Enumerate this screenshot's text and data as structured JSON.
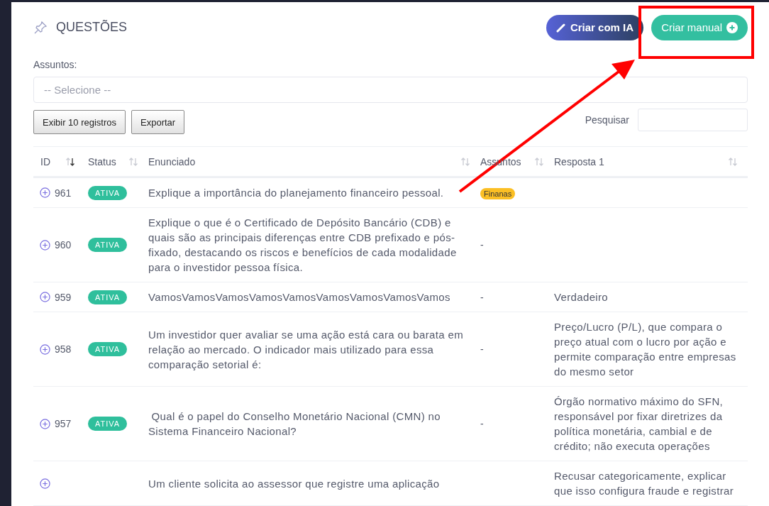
{
  "page": {
    "title": "QUESTÕES"
  },
  "actions": [
    {
      "label": "Criar com IA",
      "kind": "ai"
    },
    {
      "label": "Criar manual",
      "kind": "manual"
    }
  ],
  "filter": {
    "label": "Assuntos:",
    "placeholder": "-- Selecione --"
  },
  "toolbar": {
    "buttons": [
      "Exibir 10 registros",
      "Exportar"
    ],
    "search_label": "Pesquisar"
  },
  "table": {
    "columns": [
      {
        "label": "ID",
        "sorted": true
      },
      {
        "label": "Status",
        "sorted": false
      },
      {
        "label": "Enunciado",
        "sorted": false
      },
      {
        "label": "Assuntos",
        "sorted": false
      },
      {
        "label": "Resposta 1",
        "sorted": false
      }
    ],
    "rows": [
      {
        "id": "961",
        "status": "ATIVA",
        "enunciado": "Explique a importância do planejamento financeiro pessoal.",
        "assuntos": [
          {
            "label": "Finanas",
            "color": "#fbbf24"
          }
        ],
        "resposta": ""
      },
      {
        "id": "960",
        "status": "ATIVA",
        "enunciado": "Explique o que é o Certificado de Depósito Bancário (CDB) e quais são as principais diferenças entre CDB prefixado e pós-fixado, destacando os riscos e benefícios de cada modalidade para o investidor pessoa física.",
        "assuntos_text": "-",
        "resposta": ""
      },
      {
        "id": "959",
        "status": "ATIVA",
        "enunciado": "VamosVamosVamosVamosVamosVamosVamosVamosVamos",
        "assuntos_text": "-",
        "resposta": "Verdadeiro"
      },
      {
        "id": "958",
        "status": "ATIVA",
        "enunciado": "Um investidor quer avaliar se uma ação está cara ou barata em relação ao mercado. O indicador mais utilizado para essa comparação setorial é:",
        "assuntos_text": "-",
        "resposta": "Preço/Lucro (P/L), que compara o preço atual com o lucro por ação e permite comparação entre empresas do mesmo setor"
      },
      {
        "id": "957",
        "status": "ATIVA",
        "enunciado": " Qual é o papel do Conselho Monetário Nacional (CMN) no Sistema Financeiro Nacional?",
        "assuntos_text": "-",
        "resposta": "Órgão normativo máximo do SFN, responsável por fixar diretrizes da política monetária, cambial e de crédito; não executa operações"
      },
      {
        "enunciado": "Um cliente solicita ao assessor que registre uma aplicação",
        "resposta": "Recusar categoricamente, explicar que isso configura fraude e registrar"
      }
    ]
  }
}
